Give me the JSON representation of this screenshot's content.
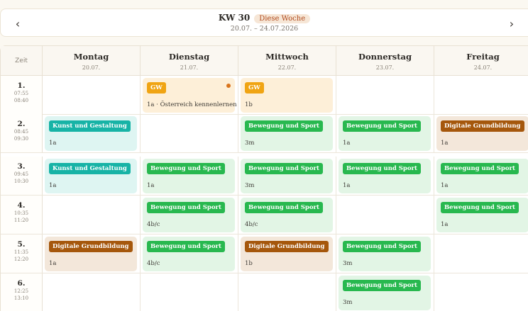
{
  "header": {
    "prev_icon": "‹",
    "next_icon": "›",
    "week_label": "KW 30",
    "week_badge": "Diese Woche",
    "week_range": "20.07. – 24.07.2026"
  },
  "columns": {
    "zeit_label": "Zeit",
    "days": [
      {
        "name": "Montag",
        "date": "20.07."
      },
      {
        "name": "Dienstag",
        "date": "21.07."
      },
      {
        "name": "Mittwoch",
        "date": "22.07."
      },
      {
        "name": "Donnerstag",
        "date": "23.07."
      },
      {
        "name": "Freitag",
        "date": "24.07."
      }
    ]
  },
  "periods": [
    {
      "num": "1.",
      "start": "07:55",
      "end": "08:40"
    },
    {
      "num": "2.",
      "start": "08:45",
      "end": "09:30"
    },
    {
      "num": "3.",
      "start": "09:45",
      "end": "10:30"
    },
    {
      "num": "4.",
      "start": "10:35",
      "end": "11:20"
    },
    {
      "num": "5.",
      "start": "11:35",
      "end": "12:20"
    },
    {
      "num": "6.",
      "start": "12:25",
      "end": "13:10"
    }
  ],
  "subject_colors": {
    "GW": {
      "tag": "#f0a413",
      "bg": "#fdefd8"
    },
    "Kunst und Gestaltung": {
      "tag": "#17b3a6",
      "bg": "#def5f2"
    },
    "Bewegung und Sport": {
      "tag": "#28b84f",
      "bg": "#e2f5e5"
    },
    "Digitale Grundbildung": {
      "tag": "#a5570c",
      "bg": "#f3e7da"
    }
  },
  "lessons": [
    {
      "day": 1,
      "period": 0,
      "subject": "GW",
      "class": "1a · Österreich kennenlernen",
      "dot": true
    },
    {
      "day": 2,
      "period": 0,
      "subject": "GW",
      "class": "1b"
    },
    {
      "day": 0,
      "period": 1,
      "subject": "Kunst und Gestaltung",
      "class": "1a"
    },
    {
      "day": 2,
      "period": 1,
      "subject": "Bewegung und Sport",
      "class": "3m"
    },
    {
      "day": 3,
      "period": 1,
      "subject": "Bewegung und Sport",
      "class": "1a"
    },
    {
      "day": 4,
      "period": 1,
      "subject": "Digitale Grundbildung",
      "class": "1a"
    },
    {
      "day": 0,
      "period": 2,
      "subject": "Kunst und Gestaltung",
      "class": "1a"
    },
    {
      "day": 1,
      "period": 2,
      "subject": "Bewegung und Sport",
      "class": "1a"
    },
    {
      "day": 2,
      "period": 2,
      "subject": "Bewegung und Sport",
      "class": "3m"
    },
    {
      "day": 3,
      "period": 2,
      "subject": "Bewegung und Sport",
      "class": "1a"
    },
    {
      "day": 4,
      "period": 2,
      "subject": "Bewegung und Sport",
      "class": "1a"
    },
    {
      "day": 1,
      "period": 3,
      "subject": "Bewegung und Sport",
      "class": "4b/c"
    },
    {
      "day": 2,
      "period": 3,
      "subject": "Bewegung und Sport",
      "class": "4b/c"
    },
    {
      "day": 4,
      "period": 3,
      "subject": "Bewegung und Sport",
      "class": "1a"
    },
    {
      "day": 0,
      "period": 4,
      "subject": "Digitale Grundbildung",
      "class": "1a"
    },
    {
      "day": 1,
      "period": 4,
      "subject": "Bewegung und Sport",
      "class": "4b/c"
    },
    {
      "day": 2,
      "period": 4,
      "subject": "Digitale Grundbildung",
      "class": "1b"
    },
    {
      "day": 3,
      "period": 4,
      "subject": "Bewegung und Sport",
      "class": "3m"
    },
    {
      "day": 3,
      "period": 5,
      "subject": "Bewegung und Sport",
      "class": "3m"
    }
  ]
}
